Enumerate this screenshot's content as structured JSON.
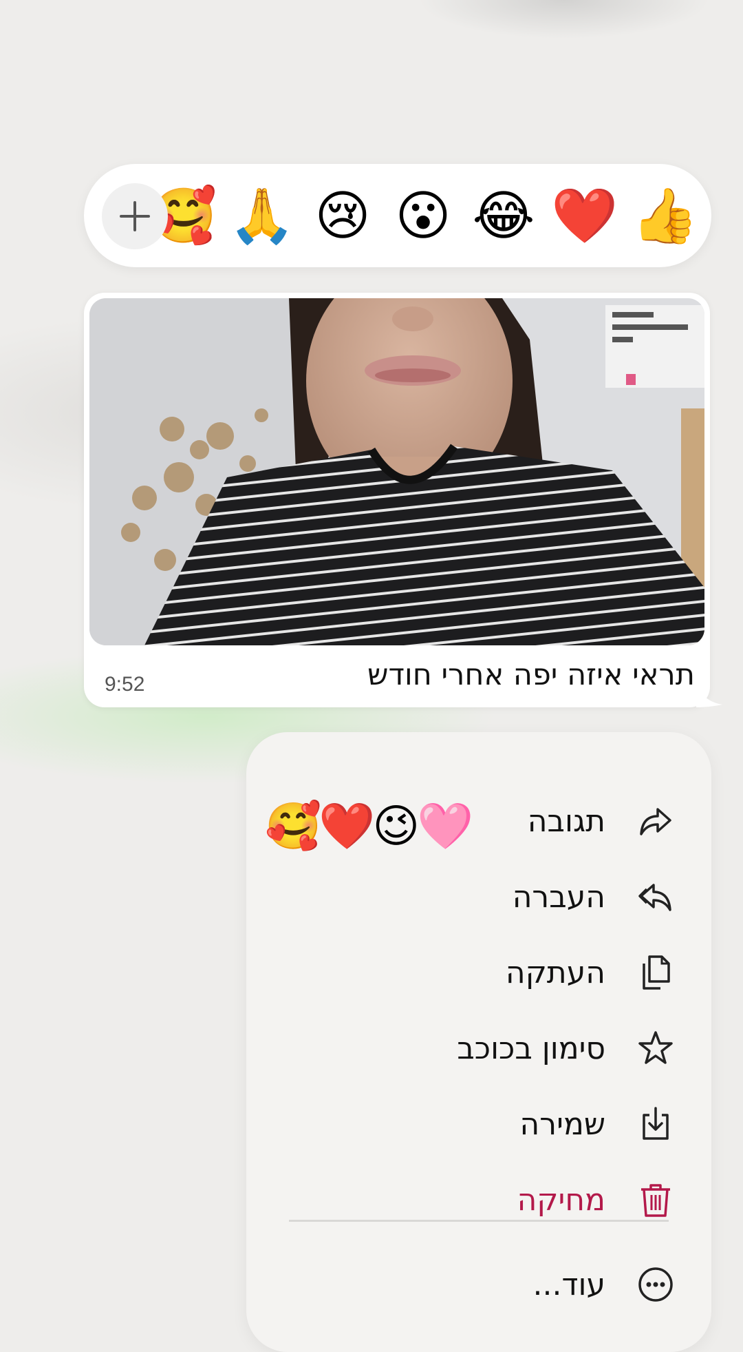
{
  "reaction_bar": {
    "emojis": [
      "👍",
      "❤️",
      "😂",
      "😮",
      "😢",
      "🙏",
      "🥰"
    ],
    "plus_symbol": "+"
  },
  "message": {
    "caption": "תראי איזה יפה אחרי חודש",
    "time": "9:52"
  },
  "sticker_reactions": "🥰❤️😉🩷",
  "context_menu": {
    "items": [
      {
        "label": "תגובה",
        "icon": "reply-arrow-icon"
      },
      {
        "label": "העברה",
        "icon": "forward-arrow-icon"
      },
      {
        "label": "העתקה",
        "icon": "copy-icon"
      },
      {
        "label": "סימון בכוכב",
        "icon": "star-icon"
      },
      {
        "label": "שמירה",
        "icon": "save-download-icon"
      },
      {
        "label": "מחיקה",
        "icon": "trash-icon"
      },
      {
        "label": "עוד...",
        "icon": "more-dots-icon"
      }
    ]
  },
  "colors": {
    "danger": "#b3194a",
    "menu_background": "#f4f3f1",
    "bubble_background": "#ffffff"
  }
}
